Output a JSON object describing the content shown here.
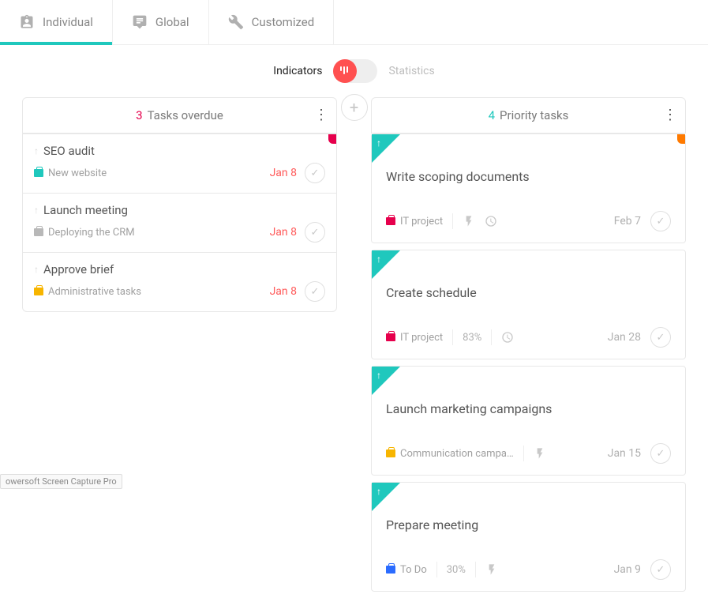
{
  "tabs": {
    "individual": "Individual",
    "global": "Global",
    "customized": "Customized"
  },
  "toggle": {
    "left": "Indicators",
    "right": "Statistics"
  },
  "columns": {
    "overdue": {
      "count": "3",
      "title": "Tasks overdue"
    },
    "priority": {
      "count": "4",
      "title": "Priority tasks"
    }
  },
  "overdue_tasks": [
    {
      "title": "SEO audit",
      "project": "New website",
      "date": "Jan 8",
      "case": "teal",
      "stub": "pink"
    },
    {
      "title": "Launch meeting",
      "project": "Deploying the CRM",
      "date": "Jan 8",
      "case": "gray",
      "stub": null
    },
    {
      "title": "Approve brief",
      "project": "Administrative tasks",
      "date": "Jan 8",
      "case": "yellow",
      "stub": null
    }
  ],
  "priority_tasks": [
    {
      "title": "Write scoping documents",
      "project": "IT project",
      "case": "pink",
      "pct": null,
      "bolt": true,
      "clock": true,
      "date": "Feb 7",
      "stub": "orange"
    },
    {
      "title": "Create schedule",
      "project": "IT project",
      "case": "pink",
      "pct": "83%",
      "bolt": false,
      "clock": true,
      "date": "Jan 28",
      "stub": null
    },
    {
      "title": "Launch marketing campaigns",
      "project": "Communication campa…",
      "case": "yellow",
      "pct": null,
      "bolt": true,
      "clock": false,
      "date": "Jan 15",
      "stub": null
    },
    {
      "title": "Prepare meeting",
      "project": "To Do",
      "case": "blue",
      "pct": "30%",
      "bolt": true,
      "clock": false,
      "date": "Jan 9",
      "stub": null
    }
  ],
  "watermark": "owersoft Screen Capture Pro"
}
